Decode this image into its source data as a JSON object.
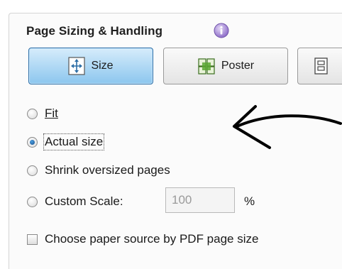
{
  "section": {
    "title": "Page Sizing & Handling"
  },
  "modes": [
    {
      "label": "Size",
      "selected": true,
      "icon": "size-icon"
    },
    {
      "label": "Poster",
      "selected": false,
      "icon": "poster-icon"
    },
    {
      "label": "",
      "selected": false,
      "icon": "multiple-pages-icon"
    }
  ],
  "options": {
    "fit": "Fit",
    "actual_size": "Actual size",
    "shrink": "Shrink oversized pages",
    "custom_scale": "Custom Scale:",
    "selected": "actual_size"
  },
  "custom_scale": {
    "value": "100",
    "unit": "%"
  },
  "paper_source": {
    "label": "Choose paper source by PDF page size",
    "checked": false
  },
  "colors": {
    "selected_button": "#8cc6ee",
    "info_icon": "#8f6fc9"
  }
}
